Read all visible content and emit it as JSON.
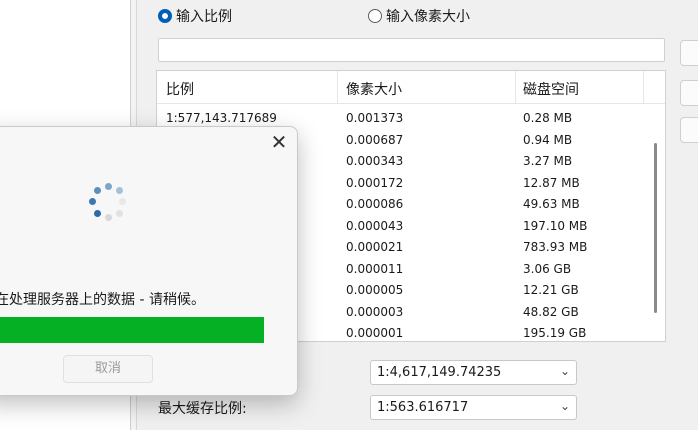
{
  "radio": {
    "option1": {
      "label": "输入比例",
      "checked": true
    },
    "option2": {
      "label": "输入像素大小",
      "checked": false
    }
  },
  "table": {
    "headers": [
      "比例",
      "像素大小",
      "磁盘空间"
    ],
    "rows": [
      [
        "1:577,143.717689",
        "0.001373",
        "0.28 MB"
      ],
      [
        "",
        "0.000687",
        "0.94 MB"
      ],
      [
        "",
        "0.000343",
        "3.27 MB"
      ],
      [
        "",
        "0.000172",
        "12.87 MB"
      ],
      [
        "",
        "0.000086",
        "49.63 MB"
      ],
      [
        "",
        "0.000043",
        "197.10 MB"
      ],
      [
        "",
        "0.000021",
        "783.93 MB"
      ],
      [
        "",
        "0.000011",
        "3.06 GB"
      ],
      [
        "",
        "0.000005",
        "12.21 GB"
      ],
      [
        "",
        "0.000003",
        "48.82 GB"
      ],
      [
        "",
        "0.000001",
        "195.19 GB"
      ]
    ]
  },
  "min_scale": {
    "value": "1:4,617,149.74235"
  },
  "max_scale": {
    "label": "最大缓存比例:",
    "value": "1:563.616717"
  },
  "dialog": {
    "message": "正在处理服务器上的数据 - 请稍候。",
    "progress": 1.0,
    "cancel_label": "取消",
    "progress_color": "#06b025"
  },
  "icons": [
    "close-icon",
    "loading-spinner-icon",
    "chevron-down-icon"
  ]
}
